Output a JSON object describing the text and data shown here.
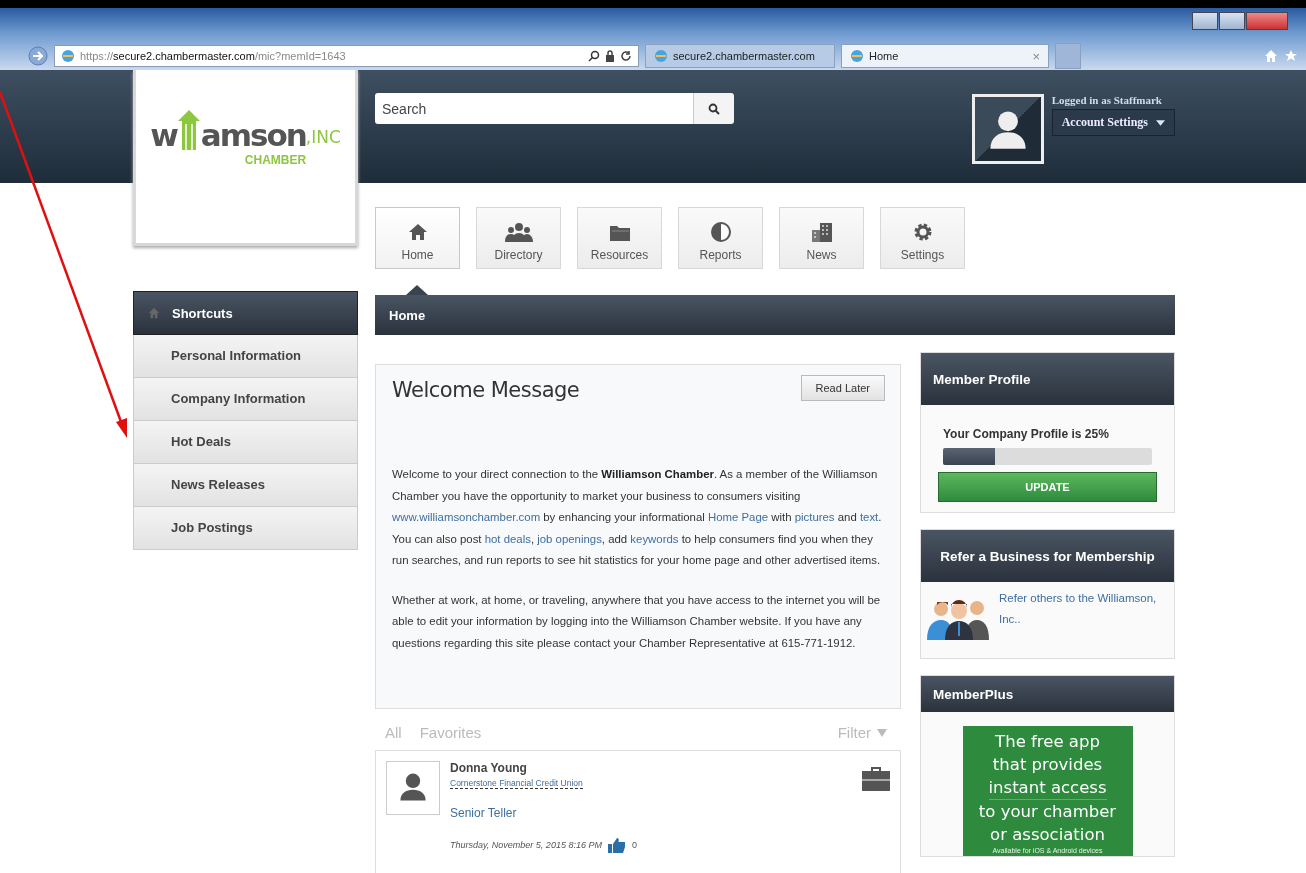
{
  "browser": {
    "address": {
      "scheme": "https://",
      "host": "secure2.chambermaster.com",
      "path": "/mic?memId=1643"
    },
    "tabs": [
      {
        "label": "secure2.chambermaster.com",
        "selected": false
      },
      {
        "label": "Home",
        "selected": true,
        "close": "×"
      }
    ]
  },
  "logo": {
    "name_start": "w",
    "name_end": "amson",
    "suffix": ",INC",
    "tagline": "CHAMBER"
  },
  "search": {
    "placeholder": "Search"
  },
  "user": {
    "logged_in": "Logged in as Staffmark",
    "account_button": "Account Settings"
  },
  "nav": [
    {
      "label": "Home",
      "kind": "home",
      "selected": true
    },
    {
      "label": "Directory",
      "kind": "people",
      "selected": false
    },
    {
      "label": "Resources",
      "kind": "folder",
      "selected": false
    },
    {
      "label": "Reports",
      "kind": "chart",
      "selected": false
    },
    {
      "label": "News",
      "kind": "building",
      "selected": false
    },
    {
      "label": "Settings",
      "kind": "gear",
      "selected": false
    }
  ],
  "breadcrumb": "Home",
  "sidebar": {
    "title": "Shortcuts",
    "items": [
      "Personal Information",
      "Company Information",
      "Hot Deals",
      "News Releases",
      "Job Postings"
    ]
  },
  "welcome": {
    "title": "Welcome Message",
    "button": "Read Later",
    "paragraphs": [
      [
        {
          "kind": "text",
          "text": "Welcome to your direct connection to the "
        },
        {
          "kind": "bold",
          "text": "Williamson Chamber"
        },
        {
          "kind": "text",
          "text": ". As a member of the Williamson Chamber you have the opportunity to market your business to consumers visiting "
        },
        {
          "kind": "link",
          "text": "www.williamsonchamber.com"
        },
        {
          "kind": "text",
          "text": " by enhancing your informational "
        },
        {
          "kind": "link",
          "text": "Home Page"
        },
        {
          "kind": "text",
          "text": " with "
        },
        {
          "kind": "link",
          "text": "pictures"
        },
        {
          "kind": "text",
          "text": " and "
        },
        {
          "kind": "link",
          "text": "text"
        },
        {
          "kind": "text",
          "text": ". You can also post "
        },
        {
          "kind": "link",
          "text": "hot deals"
        },
        {
          "kind": "text",
          "text": ", "
        },
        {
          "kind": "link",
          "text": "job openings"
        },
        {
          "kind": "text",
          "text": ", add "
        },
        {
          "kind": "link",
          "text": "keywords"
        },
        {
          "kind": "text",
          "text": " to help consumers find you when they run searches, and run reports to see hit statistics for your home page and other advertised items."
        }
      ],
      [
        {
          "kind": "text",
          "text": "Whether at work, at home, or traveling, anywhere that you have access to the internet you will be able to edit your information by logging into the Williamson Chamber website. If you have any questions regarding this site please contact your Chamber Representative at 615-771-1912."
        }
      ]
    ]
  },
  "feed": {
    "tabs": [
      "All",
      "Favorites"
    ],
    "filter": "Filter"
  },
  "post": {
    "name": "Donna Young",
    "company": "Cornerstone Financial Credit Union",
    "title": "Senior Teller",
    "date": "Thursday, November 5, 2015 8:16 PM",
    "likes": "0"
  },
  "member_profile": {
    "title": "Member Profile",
    "label": "Your Company Profile is 25%",
    "level": 0.25,
    "button": "UPDATE"
  },
  "refer": {
    "title": "Refer a Business for Membership",
    "link": "Refer others to the Williamson, Inc.."
  },
  "member_plus": {
    "title": "MemberPlus",
    "ad_lines": [
      "The free app",
      "that provides",
      "instant access",
      "to your chamber",
      "or association"
    ],
    "ad_note": "Available for iOS & Android devices"
  }
}
